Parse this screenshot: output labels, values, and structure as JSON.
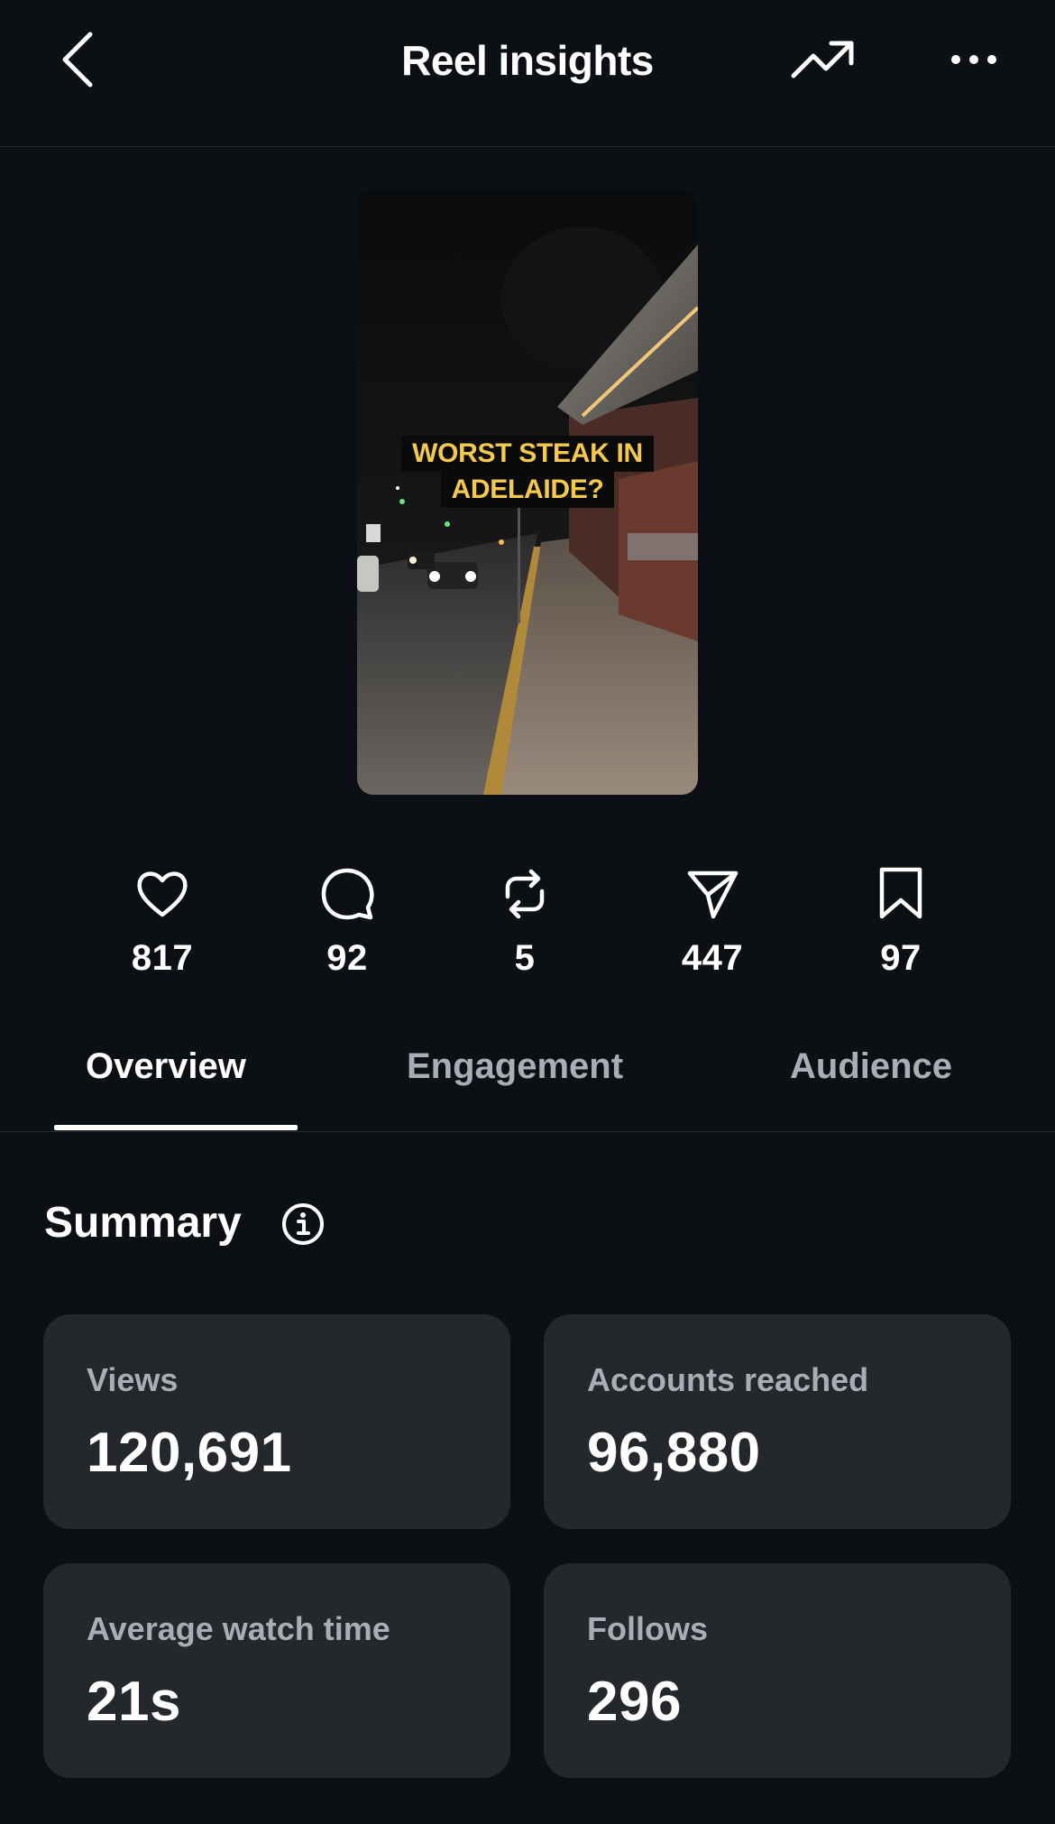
{
  "header": {
    "title": "Reel insights",
    "back_icon": "chevron-left-icon",
    "trend_icon": "trending-up-icon",
    "more_icon": "more-horizontal-icon"
  },
  "thumbnail": {
    "caption_line1": "WORST STEAK IN",
    "caption_line2": "ADELAIDE?",
    "caption_color": "#f4c94e"
  },
  "stats": [
    {
      "icon": "heart-icon",
      "value": "817"
    },
    {
      "icon": "comment-icon",
      "value": "92"
    },
    {
      "icon": "repost-icon",
      "value": "5"
    },
    {
      "icon": "share-icon",
      "value": "447"
    },
    {
      "icon": "bookmark-icon",
      "value": "97"
    }
  ],
  "tabs": [
    {
      "label": "Overview",
      "active": true
    },
    {
      "label": "Engagement",
      "active": false
    },
    {
      "label": "Audience",
      "active": false
    }
  ],
  "summary": {
    "title": "Summary",
    "cards": [
      {
        "label": "Views",
        "value": "120,691"
      },
      {
        "label": "Accounts reached",
        "value": "96,880"
      },
      {
        "label": "Average watch time",
        "value": "21s"
      },
      {
        "label": "Follows",
        "value": "296"
      }
    ]
  },
  "colors": {
    "background": "#0c1014",
    "card": "#24272c",
    "muted_text": "#a8aeb6"
  }
}
